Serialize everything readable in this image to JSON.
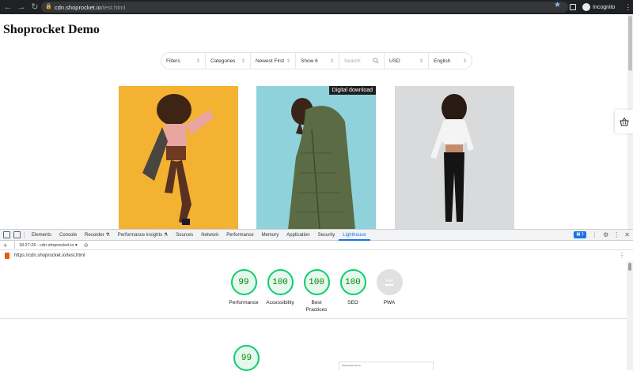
{
  "browser": {
    "url_host": "cdn.shoprocket.io",
    "url_path": "/test.html",
    "profile_label": "Incognito"
  },
  "page": {
    "title": "Shoprocket Demo",
    "filters": {
      "filters_label": "Filters",
      "categories_label": "Categories",
      "sort_label": "Newest First",
      "show_label": "Show 6",
      "search_placeholder": "Search",
      "currency_label": "USD",
      "language_label": "English"
    },
    "products": [
      {
        "image": "woman-yellow-background",
        "badge": ""
      },
      {
        "image": "man-green-jacket",
        "badge": "Digital download"
      },
      {
        "image": "woman-white-top",
        "badge": ""
      }
    ]
  },
  "devtools": {
    "tabs": [
      "Elements",
      "Console",
      "Recorder ⚗",
      "Performance insights ⚗",
      "Sources",
      "Network",
      "Performance",
      "Memory",
      "Application",
      "Security",
      "Lighthouse"
    ],
    "active_tab": "Lighthouse",
    "issues_count": "1",
    "report_selector": "18:27:26 - cdn.shoprocket.io",
    "report_url": "https://cdn.shoprocket.io/test.html",
    "scores": [
      {
        "label": "Performance",
        "value": "99"
      },
      {
        "label": "Accessibility",
        "value": "100"
      },
      {
        "label": "Best Practices",
        "value": "100"
      },
      {
        "label": "SEO",
        "value": "100"
      },
      {
        "label": "PWA",
        "value": "PWA"
      }
    ],
    "performance_score": "99",
    "preview_title": "Shoprocket Demo"
  },
  "colors": {
    "score_good": "#0cce6b",
    "active_tab": "#1a73e8",
    "chrome_bg": "#202124"
  }
}
